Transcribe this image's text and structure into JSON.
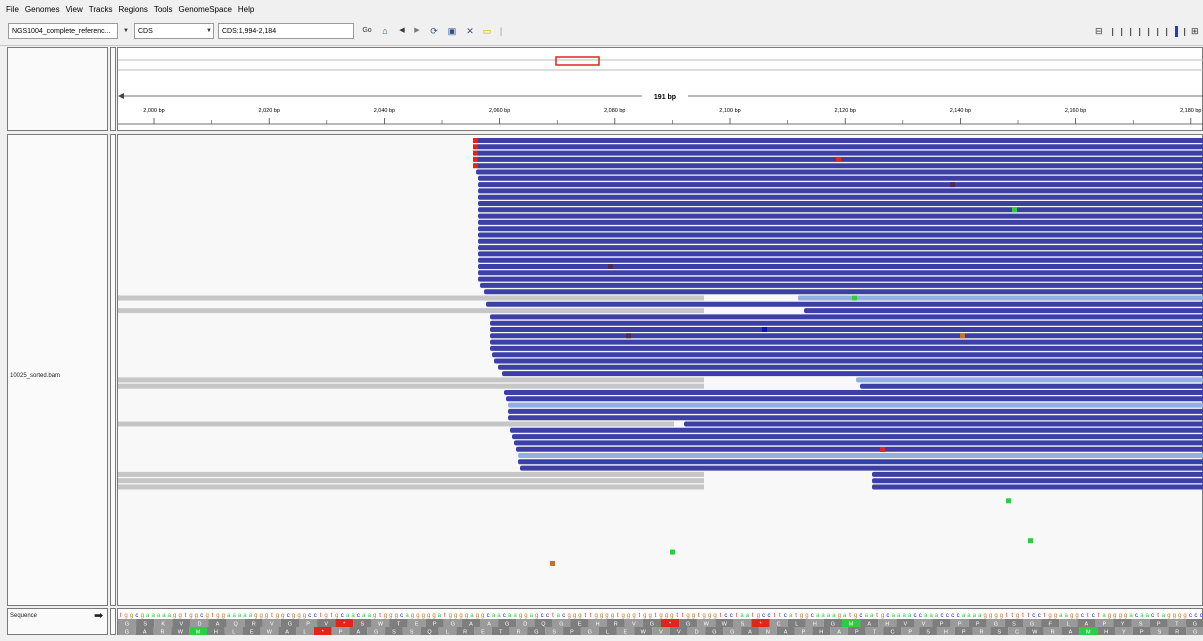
{
  "menu": [
    "File",
    "Genomes",
    "View",
    "Tracks",
    "Regions",
    "Tools",
    "GenomeSpace",
    "Help"
  ],
  "toolbar": {
    "genome": "NGS1004_complete_referenc...",
    "chromosome": "CDS",
    "locus": "CDS:1,994-2,184",
    "go_label": "Go"
  },
  "ruler": {
    "span_label": "191 bp",
    "tick_labels": [
      "2,000 bp",
      "2,020 bp",
      "2,040 bp",
      "2,060 bp",
      "2,080 bp",
      "2,100 bp",
      "2,120 bp",
      "2,140 bp",
      "2,160 bp",
      "2,180 bp"
    ]
  },
  "tracks": {
    "alignment_name": "10025_sorted.bam",
    "sequence_name": "Sequence"
  },
  "sequence": {
    "bases": "tggcgaaaaaggtggcgtggaaaaagggtggcgggcctgtgcaacaagtgggcagggggatggggaggcaacaaggagcctacgggttggggtgggtggtgggttggtgggtcctaatgccttcatggcaaaagatgcaatgcaaaaccaaaccccaaaaggggttgttcctggaaggctctaggggacaactaggggccc",
    "aa_row1": "GSKVDAQRVGPV*SWTEPGAAGDQGEHRVG*GWWS*CLHGMAHVVPPPGSGFLAPYSPTG",
    "aa_row2": "GARWMHLEWAL*PAGSSQLRETRGSPGLEWVVDGGANAPHAPTCPSHPRSCWRAMHYPSRG"
  },
  "colors": {
    "read_forward": "#3b3fa6",
    "read_reverse_light": "#93aee3",
    "read_clipped_grey": "#c6c6c6",
    "mismatch_A": "#2ecc40",
    "mismatch_C": "#1010c8",
    "mismatch_G": "#c0732a",
    "mismatch_T": "#e0261a",
    "indel": "#4a2f4a"
  }
}
